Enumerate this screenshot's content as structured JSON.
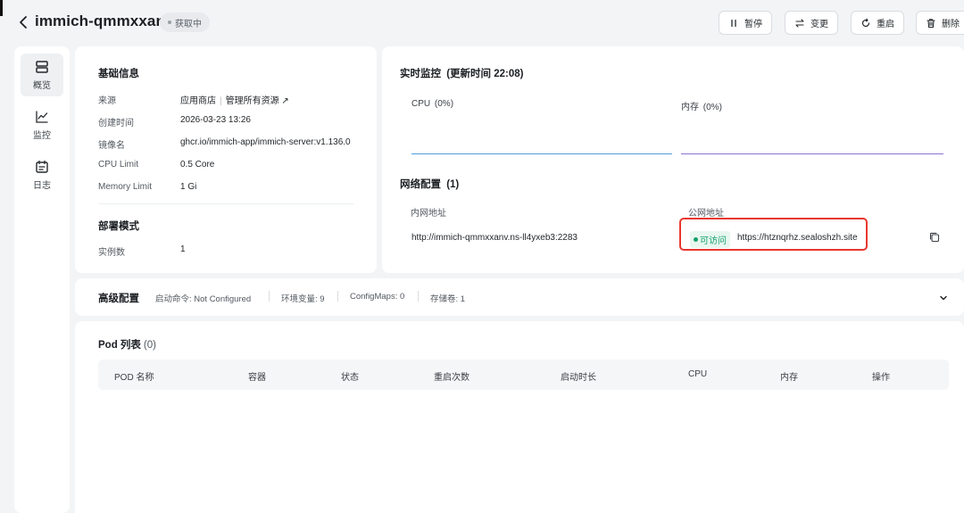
{
  "header": {
    "title": "immich-qmmxxanv",
    "status": "获取中",
    "buttons": {
      "pause": "暂停",
      "change": "变更",
      "restart": "重启",
      "delete": "删除"
    }
  },
  "nav": [
    {
      "label": "概览",
      "icon": "overview-icon",
      "active": true
    },
    {
      "label": "监控",
      "icon": "chart-icon",
      "active": false
    },
    {
      "label": "日志",
      "icon": "log-icon",
      "active": false
    }
  ],
  "basic": {
    "title": "基础信息",
    "rows": [
      {
        "k": "来源",
        "v": "应用商店",
        "v2": "管理所有资源 ↗"
      },
      {
        "k": "创建时间",
        "v": "2026-03-23 13:26"
      },
      {
        "k": "镜像名",
        "v": "ghcr.io/immich-app/immich-server:v1.136.0"
      },
      {
        "k": "CPU Limit",
        "v": "0.5 Core"
      },
      {
        "k": "Memory Limit",
        "v": "1 Gi"
      }
    ],
    "deploy_title": "部署模式",
    "deploy_key": "实例数",
    "deploy_value": "1"
  },
  "monitor": {
    "title": "实时监控",
    "updated": "(更新时间 22:08)",
    "cpu_label": "CPU",
    "cpu_value": "(0%)",
    "mem_label": "内存",
    "mem_value": "(0%)",
    "cpu_color": "#4c9ddb",
    "mem_color": "#8b72d4"
  },
  "network": {
    "title": "网络配置",
    "count": "(1)",
    "col_internal": "内网地址",
    "col_public": "公网地址",
    "internal_url": "http://immich-qmmxxanv.ns-ll4yxeb3:2283",
    "access_status": "可访问",
    "public_url": "https://htznqrhz.sealoshzh.site"
  },
  "advanced": {
    "title": "高级配置",
    "start_cmd": "启动命令: Not Configured",
    "env": "环境变量: 9",
    "configmaps": "ConfigMaps: 0",
    "storage": "存储卷: 1"
  },
  "pods": {
    "title": "Pod 列表",
    "count": "(0)",
    "columns": [
      "POD 名称",
      "容器",
      "状态",
      "重启次数",
      "启动时长",
      "CPU",
      "内存",
      "操作"
    ]
  }
}
